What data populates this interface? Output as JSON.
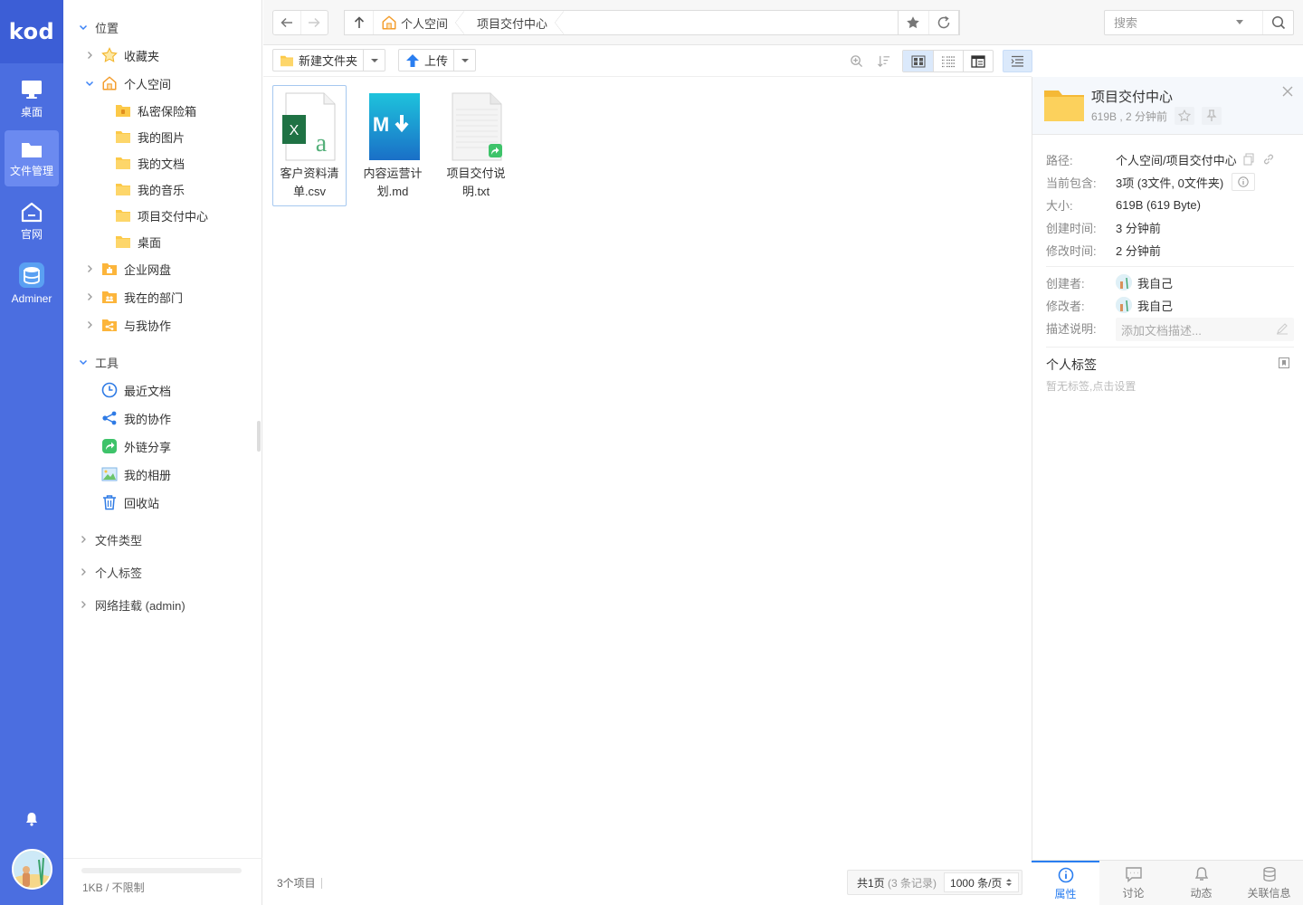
{
  "app": {
    "logo": "kod",
    "rail": [
      {
        "label": "桌面",
        "icon": "desktop-icon"
      },
      {
        "label": "文件管理",
        "icon": "folder-icon"
      },
      {
        "label": "官网",
        "icon": "home-icon"
      },
      {
        "label": "Adminer",
        "icon": "database-icon"
      }
    ]
  },
  "sidebar": {
    "location_header": "位置",
    "favorites": "收藏夹",
    "personal_space": "个人空间",
    "personal_children": [
      "私密保险箱",
      "我的图片",
      "我的文档",
      "我的音乐",
      "项目交付中心",
      "桌面"
    ],
    "enterprise": "企业网盘",
    "my_department": "我在的部门",
    "shared_with_me": "与我协作",
    "tools_header": "工具",
    "tools": [
      "最近文档",
      "我的协作",
      "外链分享",
      "我的相册",
      "回收站"
    ],
    "file_types": "文件类型",
    "personal_tags": "个人标签",
    "network_mount": "网络挂载 (admin)",
    "quota": "1KB / 不限制"
  },
  "topbar": {
    "breadcrumb": [
      "个人空间",
      "项目交付中心"
    ],
    "search_placeholder": "搜索"
  },
  "toolbar": {
    "new_folder": "新建文件夹",
    "upload": "上传"
  },
  "files": [
    {
      "name": "客户资料清单.csv",
      "type": "csv",
      "selected": true
    },
    {
      "name": "内容运营计划.md",
      "type": "md",
      "selected": false
    },
    {
      "name": "项目交付说明.txt",
      "type": "txt",
      "selected": false
    }
  ],
  "status": {
    "count": "3个项目",
    "pages": "共1页",
    "records": "(3 条记录)",
    "per_page": "1000 条/页"
  },
  "panel": {
    "title": "项目交付中心",
    "meta": "619B , 2 分钟前",
    "props": {
      "path_label": "路径:",
      "path_value": "个人空间/项目交付中心",
      "contains_label": "当前包含:",
      "contains_value": "3项 (3文件, 0文件夹)",
      "size_label": "大小:",
      "size_value": "619B (619 Byte)",
      "created_label": "创建时间:",
      "created_value": "3 分钟前",
      "modified_label": "修改时间:",
      "modified_value": "2 分钟前",
      "creator_label": "创建者:",
      "creator_value": "我自己",
      "modifier_label": "修改者:",
      "modifier_value": "我自己",
      "desc_label": "描述说明:",
      "desc_placeholder": "添加文档描述..."
    },
    "tags_title": "个人标签",
    "tags_empty": "暂无标签,点击设置",
    "tabs": [
      "属性",
      "讨论",
      "动态",
      "关联信息"
    ]
  },
  "colors": {
    "rail_bg": "#4b6ee0",
    "accent": "#2a7ef0",
    "folder": "#fcc948"
  }
}
